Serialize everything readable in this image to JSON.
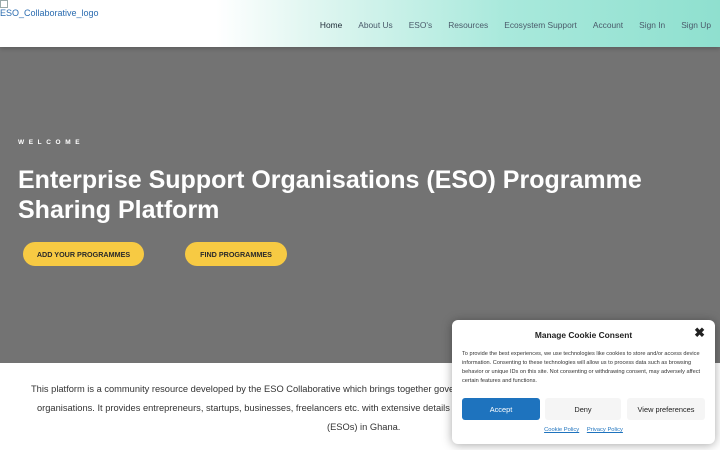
{
  "header": {
    "logo_alt": "ESO_Collaborative_logo",
    "nav": [
      "Home",
      "About Us",
      "ESO's",
      "Resources",
      "Ecosystem Support",
      "Account",
      "Sign In",
      "Sign Up"
    ]
  },
  "hero": {
    "kicker": "WELCOME",
    "title_line1": "Enterprise Support Organisations (ESO) Programme",
    "title_line2": "Sharing Platform",
    "btn_add": "ADD YOUR PROGRAMMES",
    "btn_find": "FIND PROGRAMMES"
  },
  "intro": {
    "line1": "This platform is a community resource developed by the ESO Collaborative which brings together governm",
    "line2": "organisations. It provides entrepreneurs, startups, businesses, freelancers etc. with extensive details of p",
    "line3": "(ESOs) in Ghana."
  },
  "cookie": {
    "title": "Manage Cookie Consent",
    "close_glyph": "✖",
    "body": "To provide the best experiences, we use technologies like cookies to store and/or access device information. Consenting to these technologies will allow us to process data such as browsing behavior or unique IDs on this site. Not consenting or withdrawing consent, may adversely affect certain features and functions.",
    "accept": "Accept",
    "deny": "Deny",
    "preferences": "View preferences",
    "cookie_policy": "Cookie Policy",
    "privacy_policy": "Privacy Policy"
  },
  "colors": {
    "hero_bg": "#737373",
    "button_yellow": "#f7ca43",
    "accept_blue": "#1e73be",
    "header_gradient_end": "#8fe0cf"
  }
}
